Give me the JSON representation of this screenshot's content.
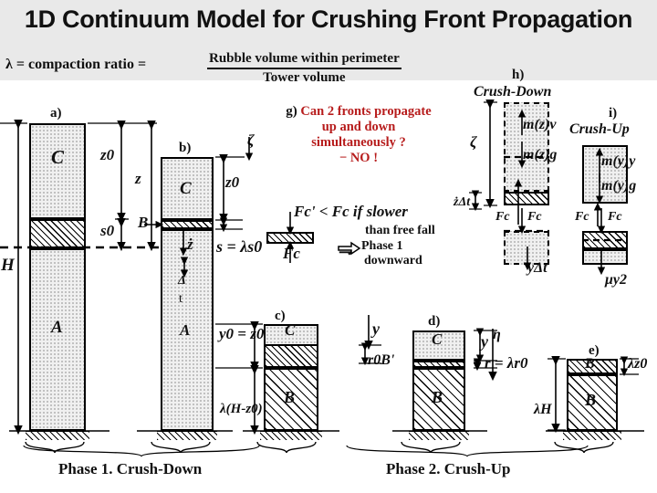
{
  "header": {
    "title": "1D Continuum Model for Crushing Front Propagation",
    "lambda_label": "λ = compaction ratio =",
    "fraction_numerator": "Rubble volume within perimeter",
    "fraction_denominator": "Tower volume"
  },
  "panels": {
    "a": {
      "id": "a)",
      "top_block_label": "C",
      "bottom_block_label": "A",
      "dim_z0": "z0",
      "dim_z": "z",
      "dim_s0": "s0",
      "dim_H": "H"
    },
    "b": {
      "id": "b)",
      "top_block_label": "C",
      "bottom_block_label": "A",
      "front_label": "B",
      "dim_z0": "z0",
      "zeta": "ζ",
      "zdot": "ż",
      "delta": "Δ",
      "t": "t",
      "s_eq": "s = λs0"
    },
    "c": {
      "id": "c)",
      "top_block_label": "C",
      "bottom_block_label": "B",
      "dim_y0": "y0 = z0",
      "dim_lambda": "λ(H-z0)",
      "y": "y",
      "r0b": "r0B'"
    },
    "d": {
      "id": "d)",
      "top_block_label": "C",
      "bottom_block_label": "B",
      "y": "y",
      "eta": "η",
      "r_eq": "r = λr0"
    },
    "e": {
      "id": "e)",
      "top_block_label": "B",
      "bottom_block_label": "B",
      "dim_lambdaH": "λH",
      "dim_lambdaz0": "λz0"
    },
    "g": {
      "id": "g)",
      "question_line1": "Can 2 fronts propagate",
      "question_line2": "up and down",
      "question_line3": "simultaneously ?",
      "answer": "− NO !"
    },
    "h": {
      "id": "h)",
      "title": "Crush-Down",
      "zeta": "ζ",
      "force_inertia": "m(z)v",
      "force_weight": "m(z)g",
      "fc_left": "Fc",
      "fc_right": "Fc",
      "dt_label": "żΔt",
      "ydt_label": "yΔt"
    },
    "i": {
      "id": "i)",
      "title": "Crush-Up",
      "force_inertia": "m(y)y",
      "force_weight": "m(y)g",
      "fc_left": "Fc",
      "fc_right": "Fc",
      "mu_label": "μy2"
    }
  },
  "notes": {
    "fc_condition": "Fc' < Fc if slower",
    "fc_condition2": "than free fall",
    "arrow": "⇒",
    "phase_result1": "Phase 1",
    "phase_result2": "downward",
    "fc_small": "Fc"
  },
  "captions": {
    "phase1": "Phase 1. Crush-Down",
    "phase2": "Phase 2. Crush-Up"
  },
  "colors": {
    "accent_red": "#b71c1c",
    "header_band": "#e9e9e9",
    "ink": "#111111"
  }
}
